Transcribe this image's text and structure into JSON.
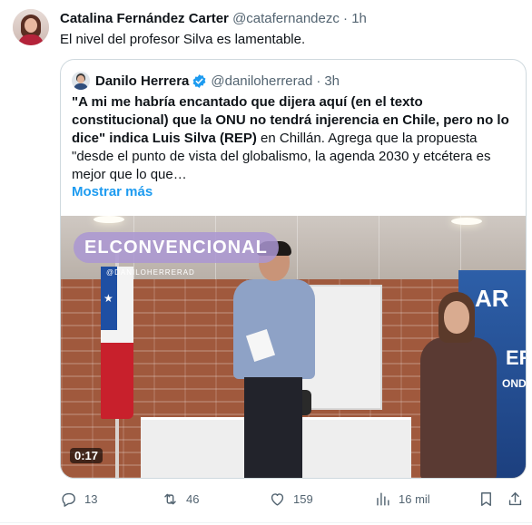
{
  "tweet": {
    "author_name": "Catalina Fernández Carter",
    "handle": "@catafernandezc",
    "separator": "·",
    "time": "1h",
    "text": "El nivel del profesor Silva es lamentable."
  },
  "quote": {
    "author_name": "Danilo Herrera",
    "handle": "@daniloherrerad",
    "separator": "·",
    "time": "3h",
    "text_bold": "\"A mi me habría encantado que dijera aquí (en el texto constitucional) que la ONU no tendrá injerencia en Chile, pero no lo dice\" indica Luis Silva (REP)",
    "text_rest": " en Chillán. Agrega que la propuesta \"desde el punto de vista del globalismo, la agenda 2030 y etcétera es mejor que lo que…",
    "show_more": "Mostrar más",
    "media": {
      "watermark": "ELCONVENCIONAL",
      "watermark_sub": "@DANILOHERRERAD",
      "banner_text_1": "AR",
      "banner_text_2": "ER",
      "banner_text_3": "ONDA",
      "duration": "0:17"
    }
  },
  "actions": {
    "replies": "13",
    "reposts": "46",
    "likes": "159",
    "views": "16 mil"
  },
  "icons": {
    "reply": "reply-icon",
    "repost": "repost-icon",
    "like": "heart-icon",
    "views": "views-chart-icon",
    "bookmark": "bookmark-icon",
    "share": "share-icon",
    "verified": "verified-badge-icon"
  },
  "colors": {
    "accent": "#1d9bf0",
    "text": "#0f1419",
    "secondary": "#536471",
    "border": "#cfd9de"
  }
}
